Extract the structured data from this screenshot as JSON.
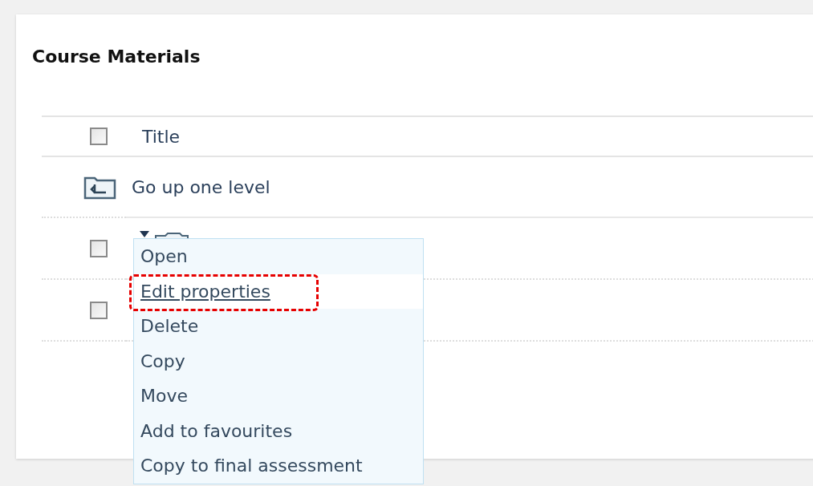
{
  "panel": {
    "title": "Course Materials"
  },
  "table": {
    "header": {
      "checked": false,
      "label": "Title"
    },
    "rows": [
      {
        "kind": "up",
        "label": "Go up one level"
      },
      {
        "kind": "folder",
        "checked": false
      },
      {
        "kind": "item",
        "checked": false
      }
    ]
  },
  "context_menu": {
    "items": [
      {
        "label": "Open",
        "selected": false,
        "annotated": false
      },
      {
        "label": "Edit properties",
        "selected": true,
        "annotated": true
      },
      {
        "label": "Delete",
        "selected": false,
        "annotated": false
      },
      {
        "label": "Copy",
        "selected": false,
        "annotated": false
      },
      {
        "label": "Move",
        "selected": false,
        "annotated": false
      },
      {
        "label": "Add to favourites",
        "selected": false,
        "annotated": false
      },
      {
        "label": "Copy to final assessment",
        "selected": false,
        "annotated": false
      }
    ]
  }
}
